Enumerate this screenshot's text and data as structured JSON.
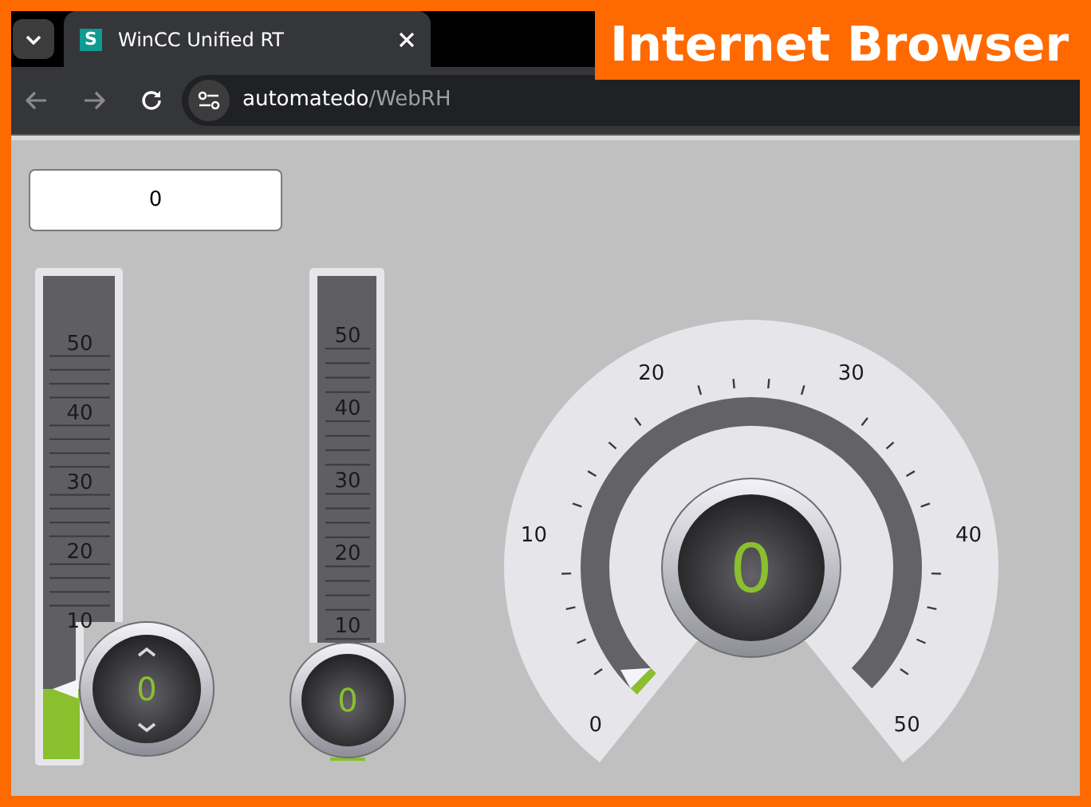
{
  "banner": {
    "text": "Internet Browser"
  },
  "browser": {
    "tab": {
      "favicon": "S",
      "title": "WinCC Unified RT"
    },
    "address": {
      "host": "automatedo",
      "path": "/WebRH"
    }
  },
  "hmi": {
    "io_field": {
      "value": "0"
    },
    "sliders": [
      {
        "kind": "spin",
        "scale": [
          "50",
          "40",
          "30",
          "20",
          "10"
        ],
        "level": 0,
        "value": "0"
      },
      {
        "kind": "plain",
        "scale": [
          "50",
          "40",
          "30",
          "20",
          "10"
        ],
        "level": 0,
        "value": "0"
      }
    ],
    "gauge": {
      "scale": [
        "0",
        "10",
        "20",
        "30",
        "40",
        "50"
      ],
      "level": 0,
      "value": "0"
    }
  }
}
